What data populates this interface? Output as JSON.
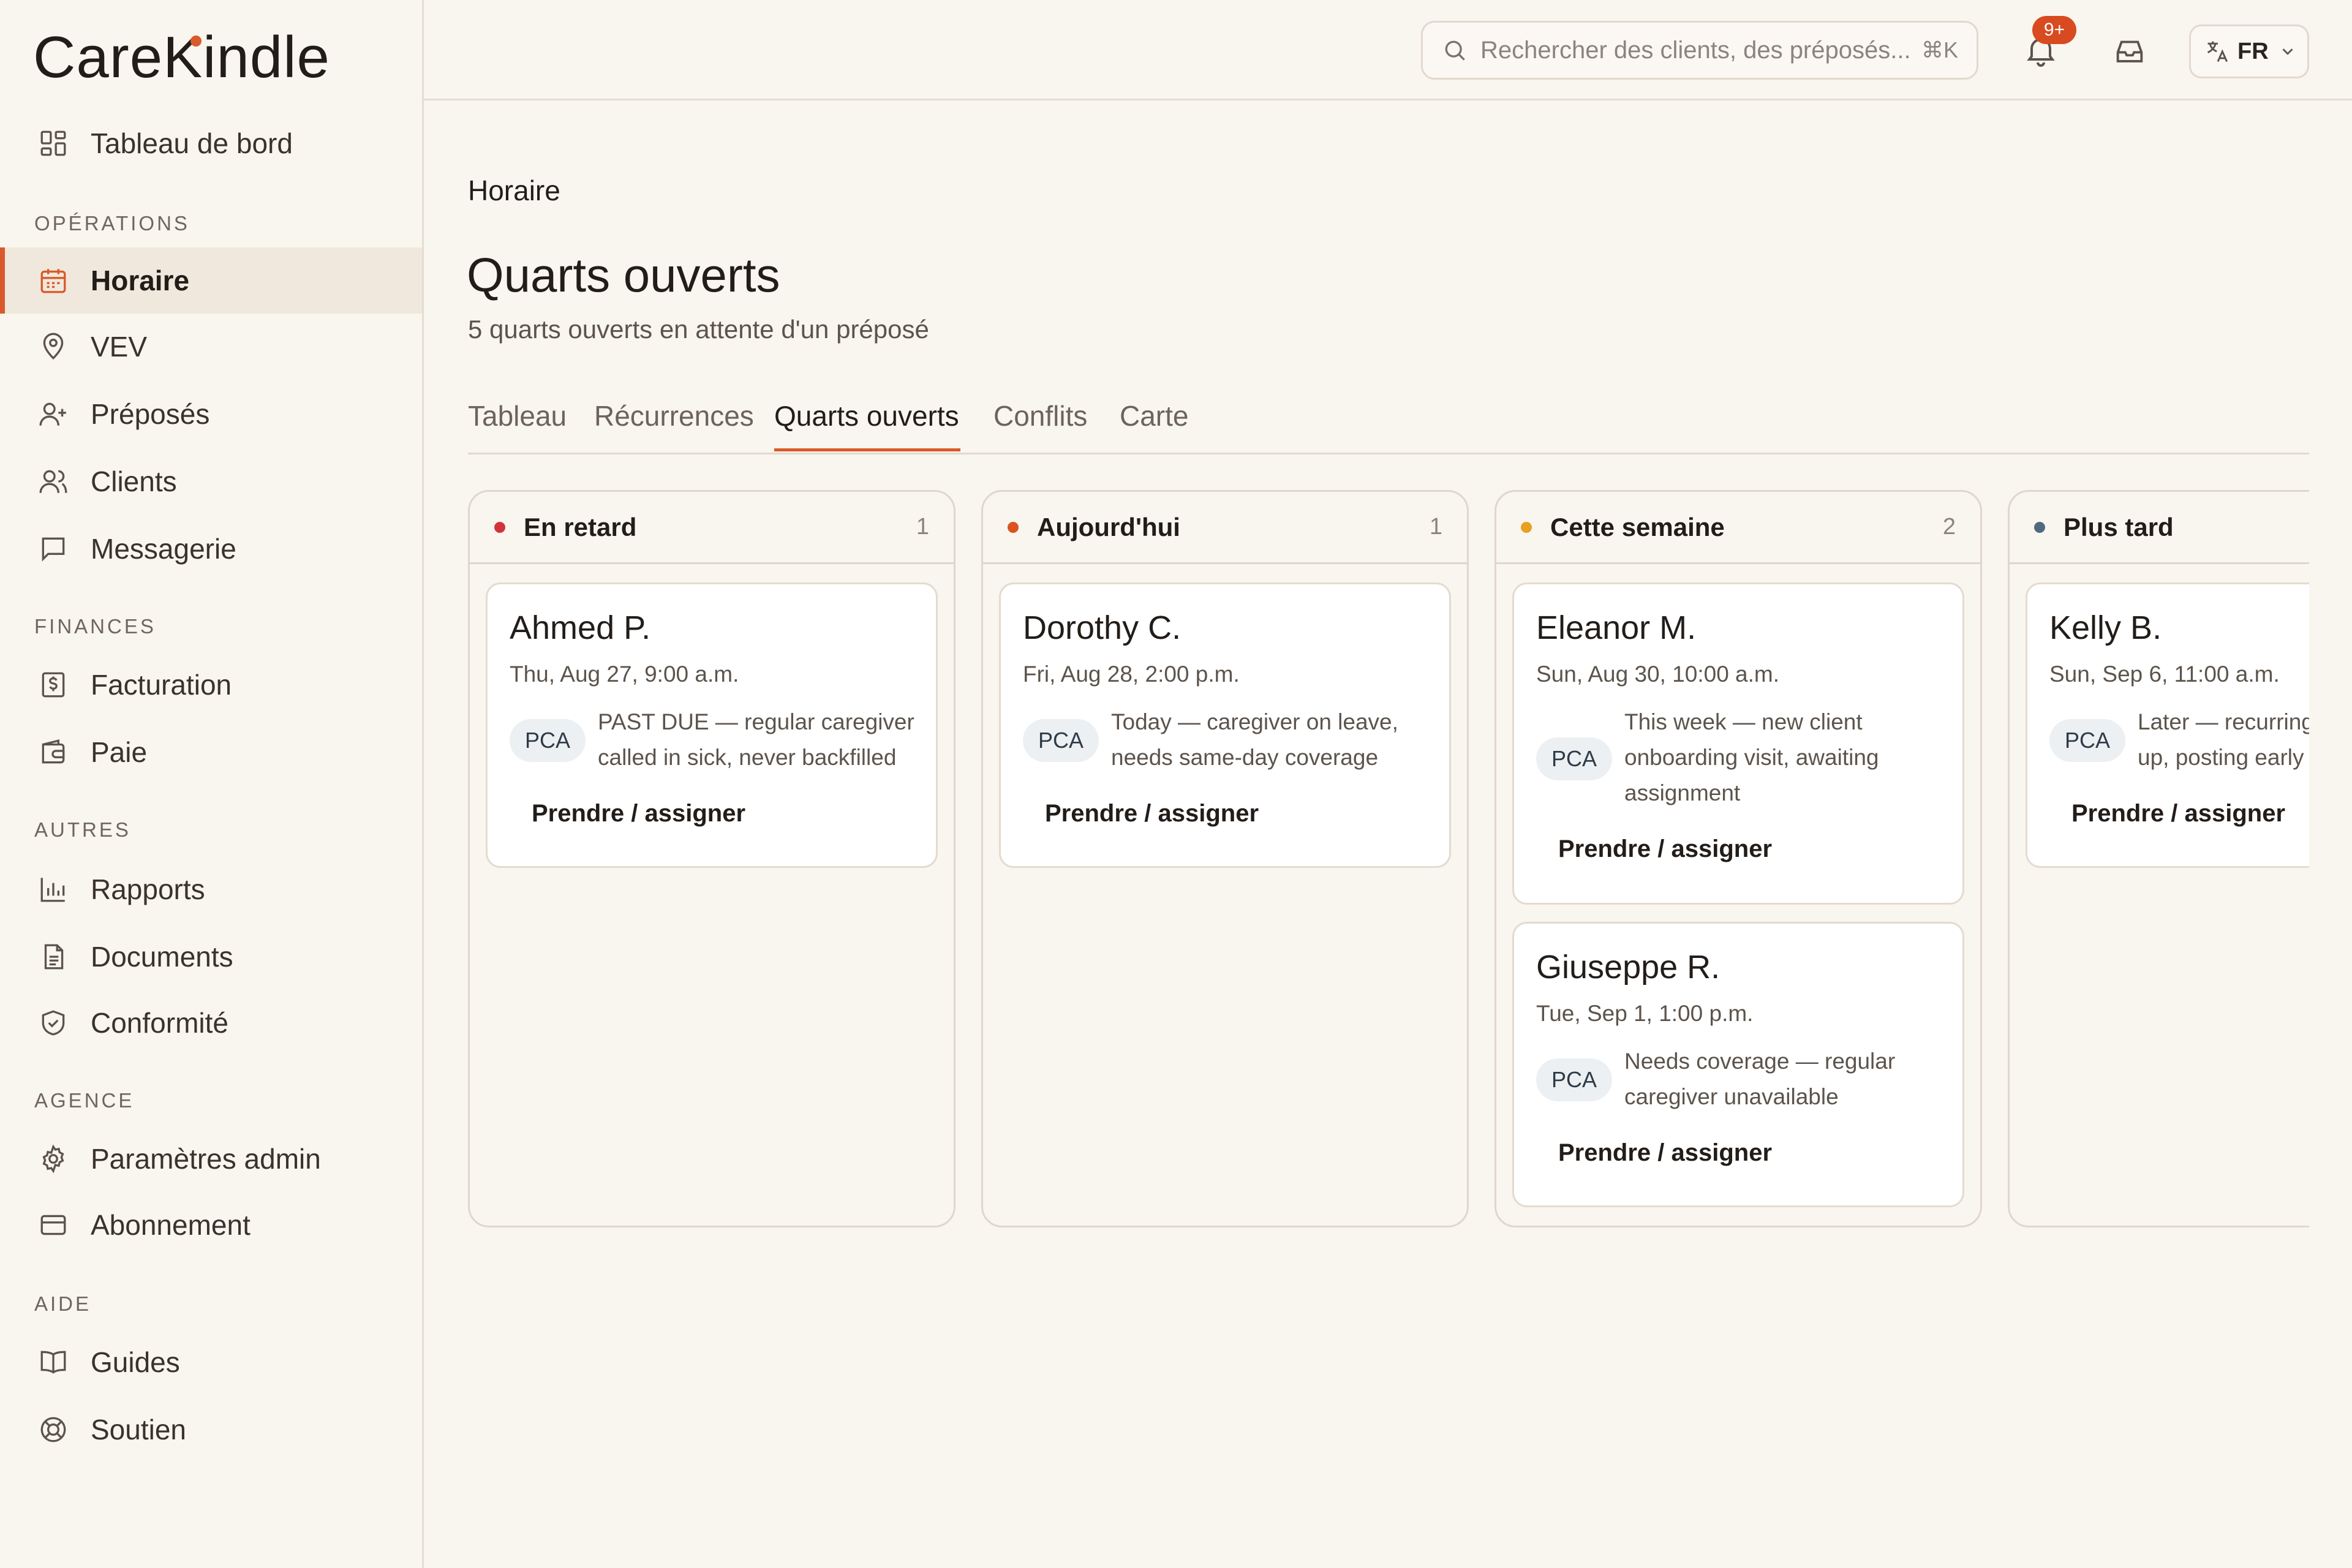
{
  "app": {
    "logo_text": "CareKindle"
  },
  "sidebar": {
    "top_item": {
      "label": "Tableau de bord",
      "icon": "dashboard-grid-icon"
    },
    "sections": [
      {
        "title": "OPÉRATIONS",
        "items": [
          {
            "label": "Horaire",
            "icon": "calendar-icon",
            "active": true
          },
          {
            "label": "VEV",
            "icon": "map-pin-icon"
          },
          {
            "label": "Préposés",
            "icon": "user-plus-icon"
          },
          {
            "label": "Clients",
            "icon": "users-icon"
          },
          {
            "label": "Messagerie",
            "icon": "message-icon"
          }
        ]
      },
      {
        "title": "FINANCES",
        "items": [
          {
            "label": "Facturation",
            "icon": "invoice-dollar-icon"
          },
          {
            "label": "Paie",
            "icon": "wallet-icon"
          }
        ]
      },
      {
        "title": "AUTRES",
        "items": [
          {
            "label": "Rapports",
            "icon": "bar-chart-icon"
          },
          {
            "label": "Documents",
            "icon": "document-icon"
          },
          {
            "label": "Conformité",
            "icon": "shield-check-icon"
          }
        ]
      },
      {
        "title": "AGENCE",
        "items": [
          {
            "label": "Paramètres admin",
            "icon": "gear-icon"
          },
          {
            "label": "Abonnement",
            "icon": "credit-card-icon"
          }
        ]
      },
      {
        "title": "AIDE",
        "items": [
          {
            "label": "Guides",
            "icon": "book-icon"
          },
          {
            "label": "Soutien",
            "icon": "lifebuoy-icon"
          }
        ]
      }
    ]
  },
  "topbar": {
    "search_placeholder": "Rechercher des clients, des préposés...",
    "search_shortcut": "⌘K",
    "notifications_badge": "9+",
    "language": "FR"
  },
  "page": {
    "breadcrumb": "Horaire",
    "title": "Quarts ouverts",
    "subtitle": "5 quarts ouverts en attente d'un préposé",
    "tabs": [
      {
        "label": "Tableau"
      },
      {
        "label": "Récurrences"
      },
      {
        "label": "Quarts ouverts",
        "active": true
      },
      {
        "label": "Conflits"
      },
      {
        "label": "Carte"
      }
    ]
  },
  "colors": {
    "accent": "#d95a2b",
    "overdue": "#d2333a",
    "today": "#d9541e",
    "this_week": "#e8a020",
    "later": "#4f6a80"
  },
  "columns": [
    {
      "name": "En retard",
      "count": "1",
      "dot_color": "#d2333a",
      "cards": [
        {
          "name": "Ahmed P.",
          "time": "Thu, Aug 27, 9:00 a.m.",
          "tag": "PCA",
          "note": "PAST DUE — regular caregiver\ncalled in sick, never backfilled",
          "action": "Prendre / assigner"
        }
      ]
    },
    {
      "name": "Aujourd'hui",
      "count": "1",
      "dot_color": "#d9541e",
      "cards": [
        {
          "name": "Dorothy C.",
          "time": "Fri, Aug 28, 2:00 p.m.",
          "tag": "PCA",
          "note": "Today — caregiver on leave,\nneeds same-day coverage",
          "action": "Prendre / assigner"
        }
      ]
    },
    {
      "name": "Cette semaine",
      "count": "2",
      "dot_color": "#e8a020",
      "cards": [
        {
          "name": "Eleanor M.",
          "time": "Sun, Aug 30, 10:00 a.m.",
          "tag": "PCA",
          "note": "This week — new client\nonboarding visit, awaiting\nassignment",
          "action": "Prendre / assigner"
        },
        {
          "name": "Giuseppe R.",
          "time": "Tue, Sep 1, 1:00 p.m.",
          "tag": "PCA",
          "note": "Needs coverage — regular\ncaregiver unavailable",
          "action": "Prendre / assigner"
        }
      ]
    },
    {
      "name": "Plus tard",
      "count": "",
      "dot_color": "#4f6a80",
      "cards": [
        {
          "name": "Kelly B.",
          "time": "Sun, Sep 6, 11:00 a.m.",
          "tag": "PCA",
          "note": "Later — recurring follow-\nup, posting early",
          "action": "Prendre / assigner"
        }
      ]
    }
  ]
}
